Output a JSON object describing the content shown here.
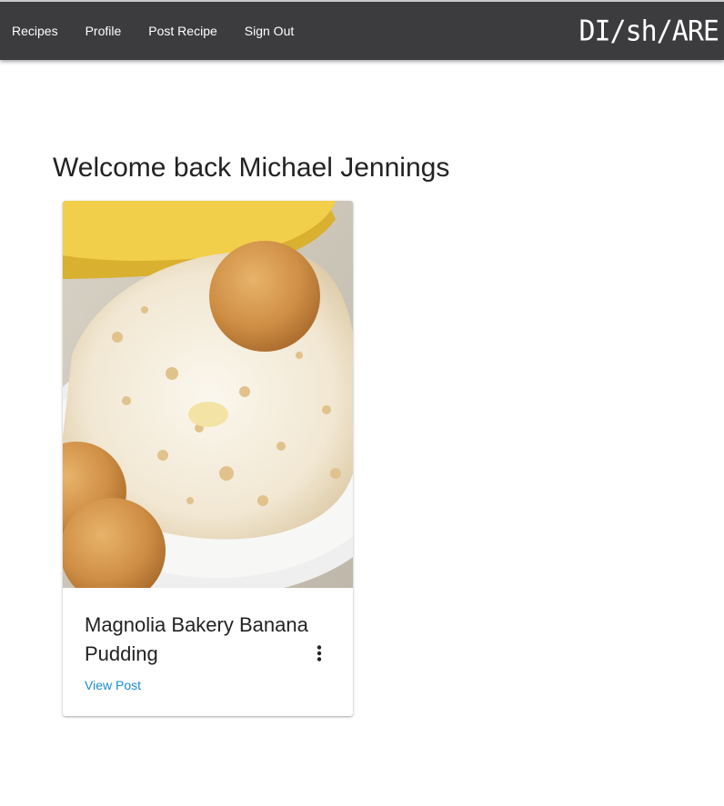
{
  "nav": {
    "items": [
      {
        "label": "Recipes"
      },
      {
        "label": "Profile"
      },
      {
        "label": "Post Recipe"
      },
      {
        "label": "Sign Out"
      }
    ],
    "logo": "DI/sh/ARE",
    "background": "#3c3c3e"
  },
  "main": {
    "welcome": "Welcome back Michael Jennings"
  },
  "recipes": [
    {
      "title": "Magnolia Bakery Banana Pudding",
      "action_label": "View Post",
      "menu_icon": "more-vert-icon",
      "image": "banana-pudding-photo"
    }
  ],
  "colors": {
    "link": "#1a8ccc",
    "text": "#222222"
  }
}
